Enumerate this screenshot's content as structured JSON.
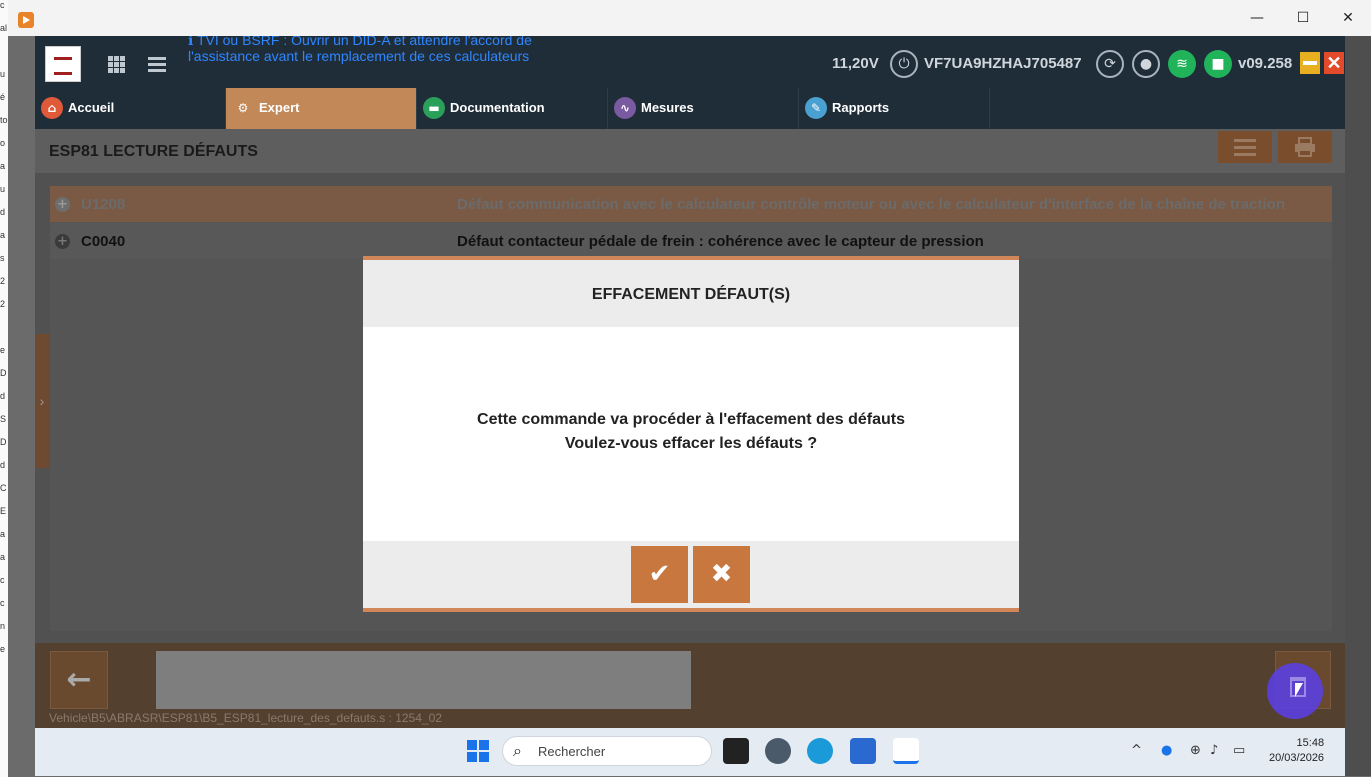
{
  "window": {
    "minimize": "—",
    "maximize": "☐",
    "close": "✕"
  },
  "topbar": {
    "info_line1": "ℹ TVI ou BSRF : Ouvrir un DID-A et attendre l'accord de",
    "info_line2": "l'assistance avant le remplacement de ces calculateurs",
    "battery": "11,20V",
    "vin": "VF7UA9HZHAJ705487",
    "version": "v09.258"
  },
  "tabs": [
    {
      "label": "Accueil",
      "color": "#e05a3a"
    },
    {
      "label": "Expert",
      "color": "#c28857"
    },
    {
      "label": "Documentation",
      "color": "#2aa05a"
    },
    {
      "label": "Mesures",
      "color": "#7a5aa0"
    },
    {
      "label": "Rapports",
      "color": "#4aa0d0"
    }
  ],
  "page": {
    "title": "ESP81 LECTURE DÉFAUTS"
  },
  "faults": [
    {
      "code": "U1208",
      "description": "Défaut communication avec le calculateur contrôle moteur ou avec le calculateur d'interface de la chaîne de traction"
    },
    {
      "code": "C0040",
      "description": "Défaut contacteur pédale de frein : cohérence avec le capteur de pression"
    }
  ],
  "modal": {
    "title": "EFFACEMENT DÉFAUT(S)",
    "message_line1": "Cette commande va procéder à l'effacement des défauts",
    "message_line2": "Voulez-vous effacer les défauts ?",
    "confirm": "✔",
    "cancel": "✖"
  },
  "bottom": {
    "path": "Vehicle\\B5\\ABRASR\\ESP81\\B5_ESP81_lecture_des_defauts.s : 1254_02"
  },
  "taskbar": {
    "search_placeholder": "Rechercher",
    "time": "15:48",
    "date": "20/03/2026"
  }
}
